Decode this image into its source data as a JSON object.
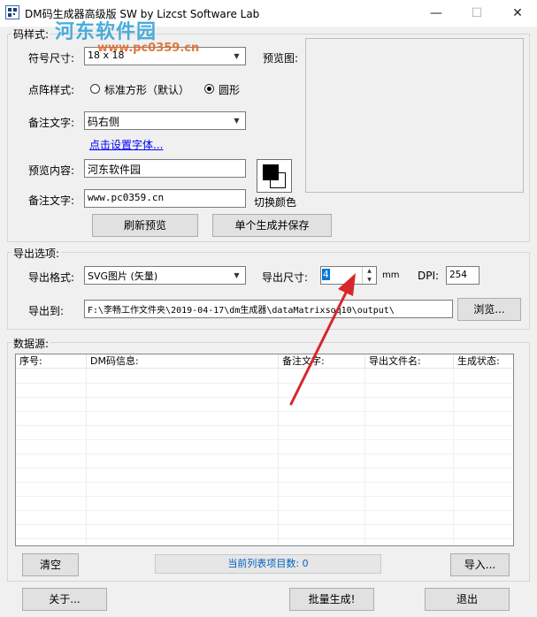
{
  "window": {
    "title": "DM码生成器高级版 SW  by Lizcst Software Lab",
    "minimize": "—",
    "maximize": "☐",
    "close": "✕"
  },
  "watermark": {
    "text": "河东软件园",
    "url": "www.pc0359.cn"
  },
  "code_style": {
    "legend": "码样式:",
    "size_label": "符号尺寸:",
    "size_value": "18 x 18",
    "dot_style_label": "点阵样式:",
    "dot_options": [
      {
        "label": "标准方形（默认）",
        "selected": false
      },
      {
        "label": "圆形",
        "selected": true
      }
    ],
    "note_label": "备注文字:",
    "note_value": "码右侧",
    "font_link": "点击设置字体...",
    "preview_content_label": "预览内容:",
    "preview_content_value": "河东软件园",
    "note_text_label": "备注文字:",
    "note_text_value": "www.pc0359.cn",
    "preview_label": "预览图:",
    "switch_color_label": "切换颜色",
    "refresh_button": "刷新预览",
    "single_save_button": "单个生成并保存"
  },
  "export": {
    "legend": "导出选项:",
    "format_label": "导出格式:",
    "format_value": "SVG图片 (矢量)",
    "size_label": "导出尺寸:",
    "size_value": "4",
    "size_unit": "mm",
    "dpi_label": "DPI:",
    "dpi_value": "254",
    "path_label": "导出到:",
    "path_value": "F:\\李畅工作文件夹\\2019-04-17\\dm生成器\\dataMatrixsoq10\\output\\",
    "browse_button": "浏览..."
  },
  "data_source": {
    "legend": "数据源:",
    "columns": [
      "序号:",
      "DM码信息:",
      "备注文字:",
      "导出文件名:",
      "生成状态:"
    ],
    "rows": [],
    "clear_button": "清空",
    "status_text": "当前列表项目数: 0",
    "import_button": "导入..."
  },
  "footer": {
    "about_button": "关于...",
    "batch_button": "批量生成!",
    "exit_button": "退出"
  },
  "colors": {
    "annotation_arrow": "#d9262b",
    "status_text": "#0060c0",
    "link": "#0000ff"
  },
  "icons": [
    "app-icon",
    "dropdown-arrow-icon",
    "spin-up-icon",
    "spin-down-icon",
    "annotation-arrow-icon"
  ]
}
